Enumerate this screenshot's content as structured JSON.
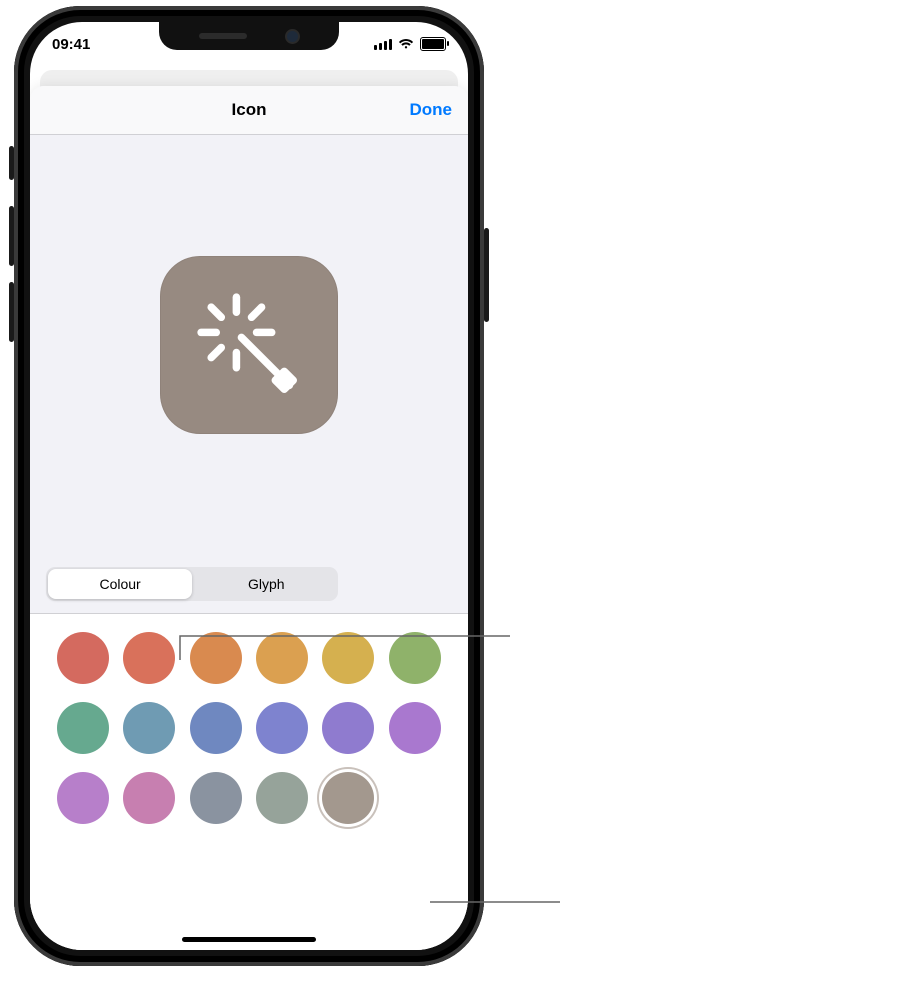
{
  "status": {
    "time": "09:41"
  },
  "sheet": {
    "title": "Icon",
    "done_label": "Done"
  },
  "preview": {
    "tile_color": "#978a81",
    "glyph": "wand-sparkle-icon"
  },
  "segmented": {
    "options": [
      {
        "label": "Colour",
        "selected": true
      },
      {
        "label": "Glyph",
        "selected": false
      }
    ]
  },
  "colors": [
    {
      "hex": "#d46a5f",
      "selected": false
    },
    {
      "hex": "#d9715b",
      "selected": false
    },
    {
      "hex": "#d98a4f",
      "selected": false
    },
    {
      "hex": "#dba050",
      "selected": false
    },
    {
      "hex": "#d5b04f",
      "selected": false
    },
    {
      "hex": "#8fb26a",
      "selected": false
    },
    {
      "hex": "#66a98f",
      "selected": false
    },
    {
      "hex": "#6f9bb3",
      "selected": false
    },
    {
      "hex": "#6f88c0",
      "selected": false
    },
    {
      "hex": "#7e83cf",
      "selected": false
    },
    {
      "hex": "#8f7bcf",
      "selected": false
    },
    {
      "hex": "#a978cf",
      "selected": false
    },
    {
      "hex": "#b77fca",
      "selected": false
    },
    {
      "hex": "#c77fb0",
      "selected": false
    },
    {
      "hex": "#8a93a0",
      "selected": false
    },
    {
      "hex": "#96a39a",
      "selected": false
    },
    {
      "hex": "#a3988e",
      "selected": true
    }
  ]
}
